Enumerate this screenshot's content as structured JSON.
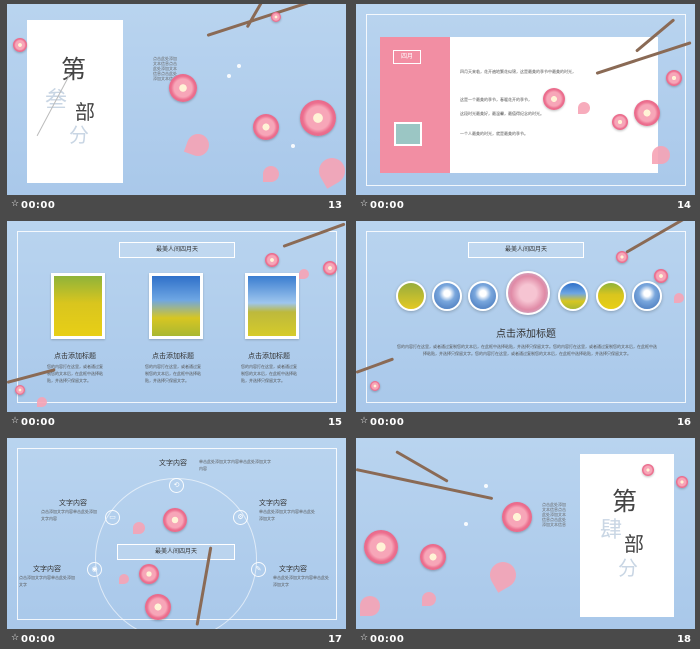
{
  "slides": [
    {
      "number": "13",
      "time": "00:00",
      "chars": [
        "第",
        "叁",
        "部",
        "分"
      ],
      "side_text": "点击此处添加文本信息点击此处添加文本信息点击此处添加文本信息"
    },
    {
      "number": "14",
      "time": "00:00",
      "tag": "四月",
      "paragraphs": [
        "四月天来临，花开遍地繁花似锦，这是最美的季节中最美的时光，",
        "这是一个最美的季节，春暖花开的季节，",
        "这段时光最美好，最温馨，最值得纪念的时光。",
        "一个人最美的时光，就是最美的季节。"
      ]
    },
    {
      "number": "15",
      "time": "00:00",
      "header": "最美人间四月天",
      "cards": [
        {
          "title": "点击添加标题",
          "body": "您的内容打在这里，或者通过复制您的文本后，在此框中选择粘贴，并选择只保留文字。"
        },
        {
          "title": "点击添加标题",
          "body": "您的内容打在这里，或者通过复制您的文本后，在此框中选择粘贴，并选择只保留文字。"
        },
        {
          "title": "点击添加标题",
          "body": "您的内容打在这里，或者通过复制您的文本后，在此框中选择粘贴，并选择只保留文字。"
        }
      ]
    },
    {
      "number": "16",
      "time": "00:00",
      "header": "最美人间四月天",
      "title": "点击添加标题",
      "body": "您的内容打在这里，或者通过复制您的文本后，在此框中选择粘贴，并选择只保留文字。您的内容打在这里，或者通过复制您的文本后，在此框中选择粘贴，并选择只保留文字。您的内容打在这里，或者通过复制您的文本后，在此框中选择粘贴，并选择只保留文字。"
    },
    {
      "number": "17",
      "time": "00:00",
      "center_label": "最美人间四月天",
      "items": [
        {
          "title": "文字内容",
          "body": "单击此处添加文字内容单击此处添加文字内容"
        },
        {
          "title": "文字内容",
          "body": "点击添加文字内容单击此处添加文字内容"
        },
        {
          "title": "文字内容",
          "body": "单击此处添加文字内容单击此处添加文字"
        },
        {
          "title": "文字内容",
          "body": "点击添加文字内容单击此处添加文字"
        },
        {
          "title": "文字内容",
          "body": "单击此处添加文字内容单击此处添加文字"
        }
      ]
    },
    {
      "number": "18",
      "time": "00:00",
      "chars": [
        "第",
        "肆",
        "部",
        "分"
      ],
      "side_text": "点击此处添加文本信息点击此处添加文本信息点击此处添加文本信息"
    }
  ],
  "colors": {
    "sky": "#b9d4ef",
    "pink": "#f28ea3",
    "branch": "#8a6a55",
    "bar": "#4a4a4a"
  },
  "icons": {
    "play": "star-icon"
  }
}
